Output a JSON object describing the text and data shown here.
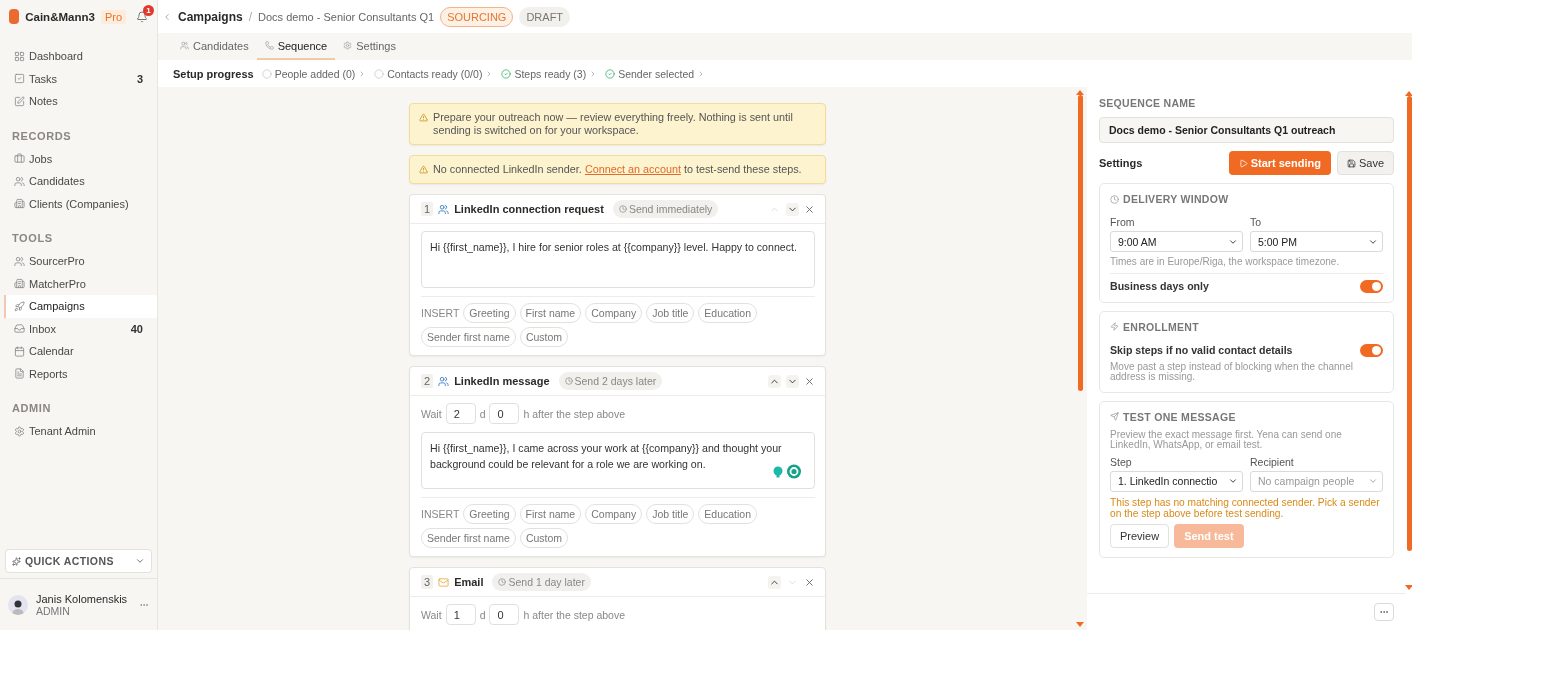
{
  "brand": {
    "name": "Cain&Mann3",
    "plan": "Pro",
    "notifications": "1"
  },
  "sidebar": {
    "sections": [
      {
        "items": [
          {
            "label": "Dashboard",
            "selected": false
          },
          {
            "label": "Tasks",
            "count": "3",
            "selected": false
          },
          {
            "label": "Notes",
            "selected": false
          }
        ]
      },
      {
        "heading": "RECORDS",
        "items": [
          {
            "label": "Jobs",
            "selected": false
          },
          {
            "label": "Candidates",
            "selected": false
          },
          {
            "label": "Clients (Companies)",
            "selected": false
          }
        ]
      },
      {
        "heading": "TOOLS",
        "items": [
          {
            "label": "SourcerPro",
            "selected": false
          },
          {
            "label": "MatcherPro",
            "selected": false
          },
          {
            "label": "Campaigns",
            "selected": true
          },
          {
            "label": "Inbox",
            "count": "40",
            "selected": false
          },
          {
            "label": "Calendar",
            "selected": false
          },
          {
            "label": "Reports",
            "selected": false
          }
        ]
      },
      {
        "heading": "ADMIN",
        "items": [
          {
            "label": "Tenant Admin",
            "selected": false
          }
        ]
      }
    ],
    "quick_actions": "QUICK ACTIONS",
    "user": {
      "name": "Janis Kolomenskis",
      "role": "ADMIN"
    }
  },
  "header": {
    "breadcrumb": "Campaigns",
    "separator": "/",
    "title": "Docs demo - Senior Consultants Q1",
    "badges": [
      {
        "label": "SOURCING",
        "kind": "status"
      },
      {
        "label": "DRAFT",
        "kind": "plain"
      }
    ]
  },
  "tabs": [
    {
      "label": "Candidates",
      "selected": false
    },
    {
      "label": "Sequence",
      "selected": true
    },
    {
      "label": "Settings",
      "selected": false
    }
  ],
  "progress": {
    "label": "Setup progress",
    "steps": [
      {
        "label": "People added (0)",
        "done": false
      },
      {
        "label": "Contacts ready (0/0)",
        "done": false
      },
      {
        "label": "Steps ready (3)",
        "done": true
      },
      {
        "label": "Sender selected",
        "done": true
      }
    ]
  },
  "banners": [
    {
      "text": "Prepare your outreach now — review everything freely. Nothing is sent until sending is switched on for your workspace."
    },
    {
      "text": "No connected LinkedIn sender.",
      "link": "Connect an account",
      "after": "to test-send these steps."
    }
  ],
  "steps": [
    {
      "number": "1",
      "kind": "linkedin",
      "title": "LinkedIn connection request",
      "timing": "Send immediately",
      "up_disabled": true,
      "down_disabled": false,
      "message": "Hi {{first_name}}, I hire for senior roles at {{company}} level. Happy to connect.",
      "insert_label": "INSERT",
      "tokens": [
        "Greeting",
        "First name",
        "Company",
        "Job title",
        "Education",
        "Sender first name",
        "Custom"
      ]
    },
    {
      "number": "2",
      "kind": "linkedin",
      "title": "LinkedIn message",
      "timing": "Send 2 days later",
      "up_disabled": false,
      "down_disabled": false,
      "wait": {
        "label": "Wait",
        "days": "2",
        "days_unit": "d",
        "hours": "0",
        "hours_unit": "h after the step above"
      },
      "message": "Hi {{first_name}}, I came across your work at {{company}} and thought your background could be relevant for a role we are working on.",
      "insert_label": "INSERT",
      "tokens": [
        "Greeting",
        "First name",
        "Company",
        "Job title",
        "Education",
        "Sender first name",
        "Custom"
      ]
    },
    {
      "number": "3",
      "kind": "email",
      "title": "Email",
      "timing": "Send 1 day later",
      "up_disabled": false,
      "down_disabled": true,
      "wait": {
        "label": "Wait",
        "days": "1",
        "days_unit": "d",
        "hours": "0",
        "hours_unit": "h after the step above"
      }
    }
  ],
  "panel": {
    "name_label": "SEQUENCE NAME",
    "name_value": "Docs demo - Senior Consultants Q1 outreach",
    "settings_label": "Settings",
    "start_button": "Start sending",
    "save_button": "Save",
    "delivery": {
      "title": "DELIVERY WINDOW",
      "from_label": "From",
      "from_value": "9:00 AM",
      "to_label": "To",
      "to_value": "5:00 PM",
      "hint": "Times are in Europe/Riga, the workspace timezone.",
      "toggle_label": "Business days only",
      "on": true
    },
    "enrollment": {
      "title": "ENROLLMENT",
      "toggle_label": "Skip steps if no valid contact details",
      "on": true,
      "hint": "Move past a step instead of blocking when the channel address is missing."
    },
    "test": {
      "title": "TEST ONE MESSAGE",
      "hint": "Preview the exact message first. Yena can send one LinkedIn, WhatsApp, or email test.",
      "step_label": "Step",
      "step_value": "1. LinkedIn connectio",
      "recipient_label": "Recipient",
      "recipient_placeholder": "No campaign people",
      "warning": "This step has no matching connected sender. Pick a sender on the step above before test sending.",
      "preview_button": "Preview",
      "send_button": "Send test",
      "send_disabled": true
    }
  }
}
